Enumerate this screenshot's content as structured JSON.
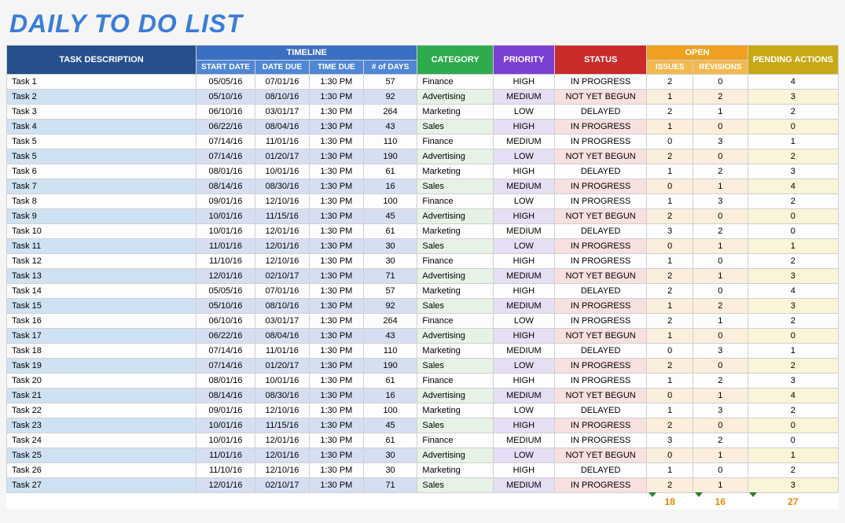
{
  "title": "DAILY TO DO LIST",
  "headers": {
    "desc": "TASK DESCRIPTION",
    "timeline": "TIMELINE",
    "start": "START DATE",
    "due": "DATE DUE",
    "time": "TIME DUE",
    "days": "# of DAYS",
    "category": "CATEGORY",
    "priority": "PRIORITY",
    "status": "STATUS",
    "open": "OPEN",
    "issues": "ISSUES",
    "revisions": "REVISIONS",
    "pending": "PENDING ACTIONS"
  },
  "rows": [
    {
      "desc": "Task 1",
      "start": "05/05/16",
      "due": "07/01/16",
      "time": "1:30 PM",
      "days": "57",
      "cat": "Finance",
      "pri": "HIGH",
      "stat": "IN PROGRESS",
      "iss": "2",
      "rev": "0",
      "pend": "4"
    },
    {
      "desc": "Task 2",
      "start": "05/10/16",
      "due": "08/10/16",
      "time": "1:30 PM",
      "days": "92",
      "cat": "Advertising",
      "pri": "MEDIUM",
      "stat": "NOT YET BEGUN",
      "iss": "1",
      "rev": "2",
      "pend": "3"
    },
    {
      "desc": "Task 3",
      "start": "06/10/16",
      "due": "03/01/17",
      "time": "1:30 PM",
      "days": "264",
      "cat": "Marketing",
      "pri": "LOW",
      "stat": "DELAYED",
      "iss": "2",
      "rev": "1",
      "pend": "2"
    },
    {
      "desc": "Task 4",
      "start": "06/22/16",
      "due": "08/04/16",
      "time": "1:30 PM",
      "days": "43",
      "cat": "Sales",
      "pri": "HIGH",
      "stat": "IN PROGRESS",
      "iss": "1",
      "rev": "0",
      "pend": "0"
    },
    {
      "desc": "Task 5",
      "start": "07/14/16",
      "due": "11/01/16",
      "time": "1:30 PM",
      "days": "110",
      "cat": "Finance",
      "pri": "MEDIUM",
      "stat": "IN PROGRESS",
      "iss": "0",
      "rev": "3",
      "pend": "1"
    },
    {
      "desc": "Task 5",
      "start": "07/14/16",
      "due": "01/20/17",
      "time": "1:30 PM",
      "days": "190",
      "cat": "Advertising",
      "pri": "LOW",
      "stat": "NOT YET BEGUN",
      "iss": "2",
      "rev": "0",
      "pend": "2"
    },
    {
      "desc": "Task 6",
      "start": "08/01/16",
      "due": "10/01/16",
      "time": "1:30 PM",
      "days": "61",
      "cat": "Marketing",
      "pri": "HIGH",
      "stat": "DELAYED",
      "iss": "1",
      "rev": "2",
      "pend": "3"
    },
    {
      "desc": "Task 7",
      "start": "08/14/16",
      "due": "08/30/16",
      "time": "1:30 PM",
      "days": "16",
      "cat": "Sales",
      "pri": "MEDIUM",
      "stat": "IN PROGRESS",
      "iss": "0",
      "rev": "1",
      "pend": "4"
    },
    {
      "desc": "Task 8",
      "start": "09/01/16",
      "due": "12/10/16",
      "time": "1:30 PM",
      "days": "100",
      "cat": "Finance",
      "pri": "LOW",
      "stat": "IN PROGRESS",
      "iss": "1",
      "rev": "3",
      "pend": "2"
    },
    {
      "desc": "Task 9",
      "start": "10/01/16",
      "due": "11/15/16",
      "time": "1:30 PM",
      "days": "45",
      "cat": "Advertising",
      "pri": "HIGH",
      "stat": "NOT YET BEGUN",
      "iss": "2",
      "rev": "0",
      "pend": "0"
    },
    {
      "desc": "Task 10",
      "start": "10/01/16",
      "due": "12/01/16",
      "time": "1:30 PM",
      "days": "61",
      "cat": "Marketing",
      "pri": "MEDIUM",
      "stat": "DELAYED",
      "iss": "3",
      "rev": "2",
      "pend": "0"
    },
    {
      "desc": "Task 11",
      "start": "11/01/16",
      "due": "12/01/16",
      "time": "1:30 PM",
      "days": "30",
      "cat": "Sales",
      "pri": "LOW",
      "stat": "IN PROGRESS",
      "iss": "0",
      "rev": "1",
      "pend": "1"
    },
    {
      "desc": "Task 12",
      "start": "11/10/16",
      "due": "12/10/16",
      "time": "1:30 PM",
      "days": "30",
      "cat": "Finance",
      "pri": "HIGH",
      "stat": "IN PROGRESS",
      "iss": "1",
      "rev": "0",
      "pend": "2"
    },
    {
      "desc": "Task 13",
      "start": "12/01/16",
      "due": "02/10/17",
      "time": "1:30 PM",
      "days": "71",
      "cat": "Advertising",
      "pri": "MEDIUM",
      "stat": "NOT YET BEGUN",
      "iss": "2",
      "rev": "1",
      "pend": "3"
    },
    {
      "desc": "Task 14",
      "start": "05/05/16",
      "due": "07/01/16",
      "time": "1:30 PM",
      "days": "57",
      "cat": "Marketing",
      "pri": "HIGH",
      "stat": "DELAYED",
      "iss": "2",
      "rev": "0",
      "pend": "4"
    },
    {
      "desc": "Task 15",
      "start": "05/10/16",
      "due": "08/10/16",
      "time": "1:30 PM",
      "days": "92",
      "cat": "Sales",
      "pri": "MEDIUM",
      "stat": "IN PROGRESS",
      "iss": "1",
      "rev": "2",
      "pend": "3"
    },
    {
      "desc": "Task 16",
      "start": "06/10/16",
      "due": "03/01/17",
      "time": "1:30 PM",
      "days": "264",
      "cat": "Finance",
      "pri": "LOW",
      "stat": "IN PROGRESS",
      "iss": "2",
      "rev": "1",
      "pend": "2"
    },
    {
      "desc": "Task 17",
      "start": "06/22/16",
      "due": "08/04/16",
      "time": "1:30 PM",
      "days": "43",
      "cat": "Advertising",
      "pri": "HIGH",
      "stat": "NOT YET BEGUN",
      "iss": "1",
      "rev": "0",
      "pend": "0"
    },
    {
      "desc": "Task 18",
      "start": "07/14/16",
      "due": "11/01/16",
      "time": "1:30 PM",
      "days": "110",
      "cat": "Marketing",
      "pri": "MEDIUM",
      "stat": "DELAYED",
      "iss": "0",
      "rev": "3",
      "pend": "1"
    },
    {
      "desc": "Task 19",
      "start": "07/14/16",
      "due": "01/20/17",
      "time": "1:30 PM",
      "days": "190",
      "cat": "Sales",
      "pri": "LOW",
      "stat": "IN PROGRESS",
      "iss": "2",
      "rev": "0",
      "pend": "2"
    },
    {
      "desc": "Task 20",
      "start": "08/01/16",
      "due": "10/01/16",
      "time": "1:30 PM",
      "days": "61",
      "cat": "Finance",
      "pri": "HIGH",
      "stat": "IN PROGRESS",
      "iss": "1",
      "rev": "2",
      "pend": "3"
    },
    {
      "desc": "Task 21",
      "start": "08/14/16",
      "due": "08/30/16",
      "time": "1:30 PM",
      "days": "16",
      "cat": "Advertising",
      "pri": "MEDIUM",
      "stat": "NOT YET BEGUN",
      "iss": "0",
      "rev": "1",
      "pend": "4"
    },
    {
      "desc": "Task 22",
      "start": "09/01/16",
      "due": "12/10/16",
      "time": "1:30 PM",
      "days": "100",
      "cat": "Marketing",
      "pri": "LOW",
      "stat": "DELAYED",
      "iss": "1",
      "rev": "3",
      "pend": "2"
    },
    {
      "desc": "Task 23",
      "start": "10/01/16",
      "due": "11/15/16",
      "time": "1:30 PM",
      "days": "45",
      "cat": "Sales",
      "pri": "HIGH",
      "stat": "IN PROGRESS",
      "iss": "2",
      "rev": "0",
      "pend": "0"
    },
    {
      "desc": "Task 24",
      "start": "10/01/16",
      "due": "12/01/16",
      "time": "1:30 PM",
      "days": "61",
      "cat": "Finance",
      "pri": "MEDIUM",
      "stat": "IN PROGRESS",
      "iss": "3",
      "rev": "2",
      "pend": "0"
    },
    {
      "desc": "Task 25",
      "start": "11/01/16",
      "due": "12/01/16",
      "time": "1:30 PM",
      "days": "30",
      "cat": "Advertising",
      "pri": "LOW",
      "stat": "NOT YET BEGUN",
      "iss": "0",
      "rev": "1",
      "pend": "1"
    },
    {
      "desc": "Task 26",
      "start": "11/10/16",
      "due": "12/10/16",
      "time": "1:30 PM",
      "days": "30",
      "cat": "Marketing",
      "pri": "HIGH",
      "stat": "DELAYED",
      "iss": "1",
      "rev": "0",
      "pend": "2"
    },
    {
      "desc": "Task 27",
      "start": "12/01/16",
      "due": "02/10/17",
      "time": "1:30 PM",
      "days": "71",
      "cat": "Sales",
      "pri": "MEDIUM",
      "stat": "IN PROGRESS",
      "iss": "2",
      "rev": "1",
      "pend": "3"
    }
  ],
  "totals": {
    "issues": "18",
    "revisions": "16",
    "pending": "27"
  }
}
